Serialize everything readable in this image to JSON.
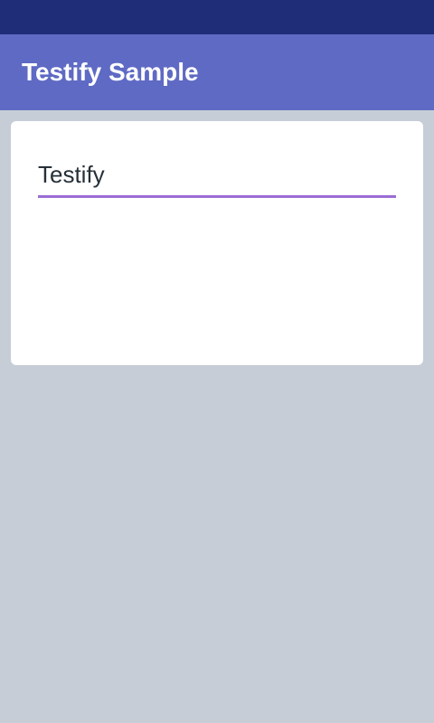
{
  "app_bar": {
    "title": "Testify Sample"
  },
  "form": {
    "text_field_value": "Testify"
  },
  "colors": {
    "status_bar": "#1f2c78",
    "app_bar": "#5f6ac4",
    "background": "#c6cdd6",
    "card": "#ffffff",
    "field_underline": "#9a6cd3"
  }
}
